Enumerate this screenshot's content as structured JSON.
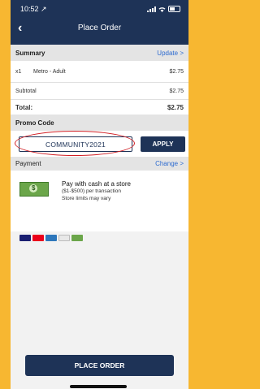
{
  "status": {
    "time": "10:52",
    "location_glyph": "↗"
  },
  "header": {
    "back_icon": "‹",
    "title": "Place Order"
  },
  "summary": {
    "label": "Summary",
    "update_label": "Update >",
    "item": {
      "qty": "x1",
      "name": "Metro - Adult",
      "price": "$2.75"
    },
    "subtotal_label": "Subtotal",
    "subtotal_value": "$2.75",
    "total_label": "Total:",
    "total_value": "$2.75"
  },
  "promo": {
    "label": "Promo Code",
    "code": "COMMUNITY2021",
    "apply_label": "APPLY"
  },
  "payment": {
    "label": "Payment",
    "change_label": "Change >",
    "method_title": "Pay with cash at a store",
    "method_range": "($1-$500) per transaction",
    "method_note": "Store limits may vary",
    "card_logos": [
      "VISA",
      "MC",
      "AMEX",
      "DISCOVER",
      "CASH"
    ]
  },
  "footer": {
    "place_order_label": "PLACE ORDER"
  },
  "colors": {
    "header": "#1e3357",
    "accent": "#2d6bd0",
    "highlight": "#d11f25",
    "background": "#f7b731"
  }
}
